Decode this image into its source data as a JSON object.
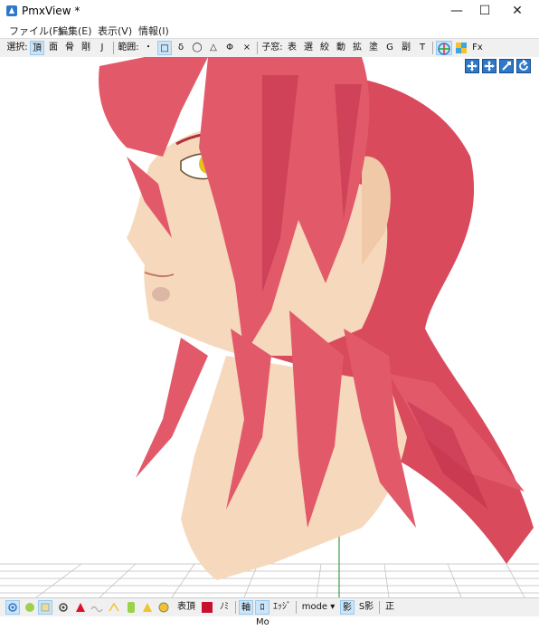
{
  "window": {
    "title": "PmxView *",
    "minimize": "—",
    "maximize": "☐",
    "close": "✕"
  },
  "menu": [
    "ファイル(F)",
    "編集(E)",
    "表示(V)",
    "情報(I)"
  ],
  "toolbar": {
    "select_label": "選択:",
    "select_modes": [
      "頂",
      "面",
      "骨",
      "剛",
      "J"
    ],
    "range_label": "範囲:",
    "range_modes": [
      "・",
      "□",
      "δ",
      "◯",
      "△",
      "Φ",
      "×"
    ],
    "child_label": "子窓:",
    "child_windows": [
      "表",
      "選",
      "絞",
      "動",
      "拡",
      "塗",
      "G",
      "副",
      "T"
    ],
    "fx_label": "Fx"
  },
  "bottombar": {
    "labels": [
      "表頂",
      "ﾉﾐ"
    ],
    "toggles": [
      "軸",
      "ﾛMo",
      "ｴｯｼﾞ"
    ],
    "mode_select": "mode ▾",
    "shadow": "影",
    "self_shadow": "S影",
    "ortho": "正"
  },
  "colors": {
    "hair": "#e25a6a",
    "hair_dark": "#c0304a",
    "skin": "#f6d9bd",
    "eye": "#e6c21a",
    "accent": "#2f78c9"
  }
}
